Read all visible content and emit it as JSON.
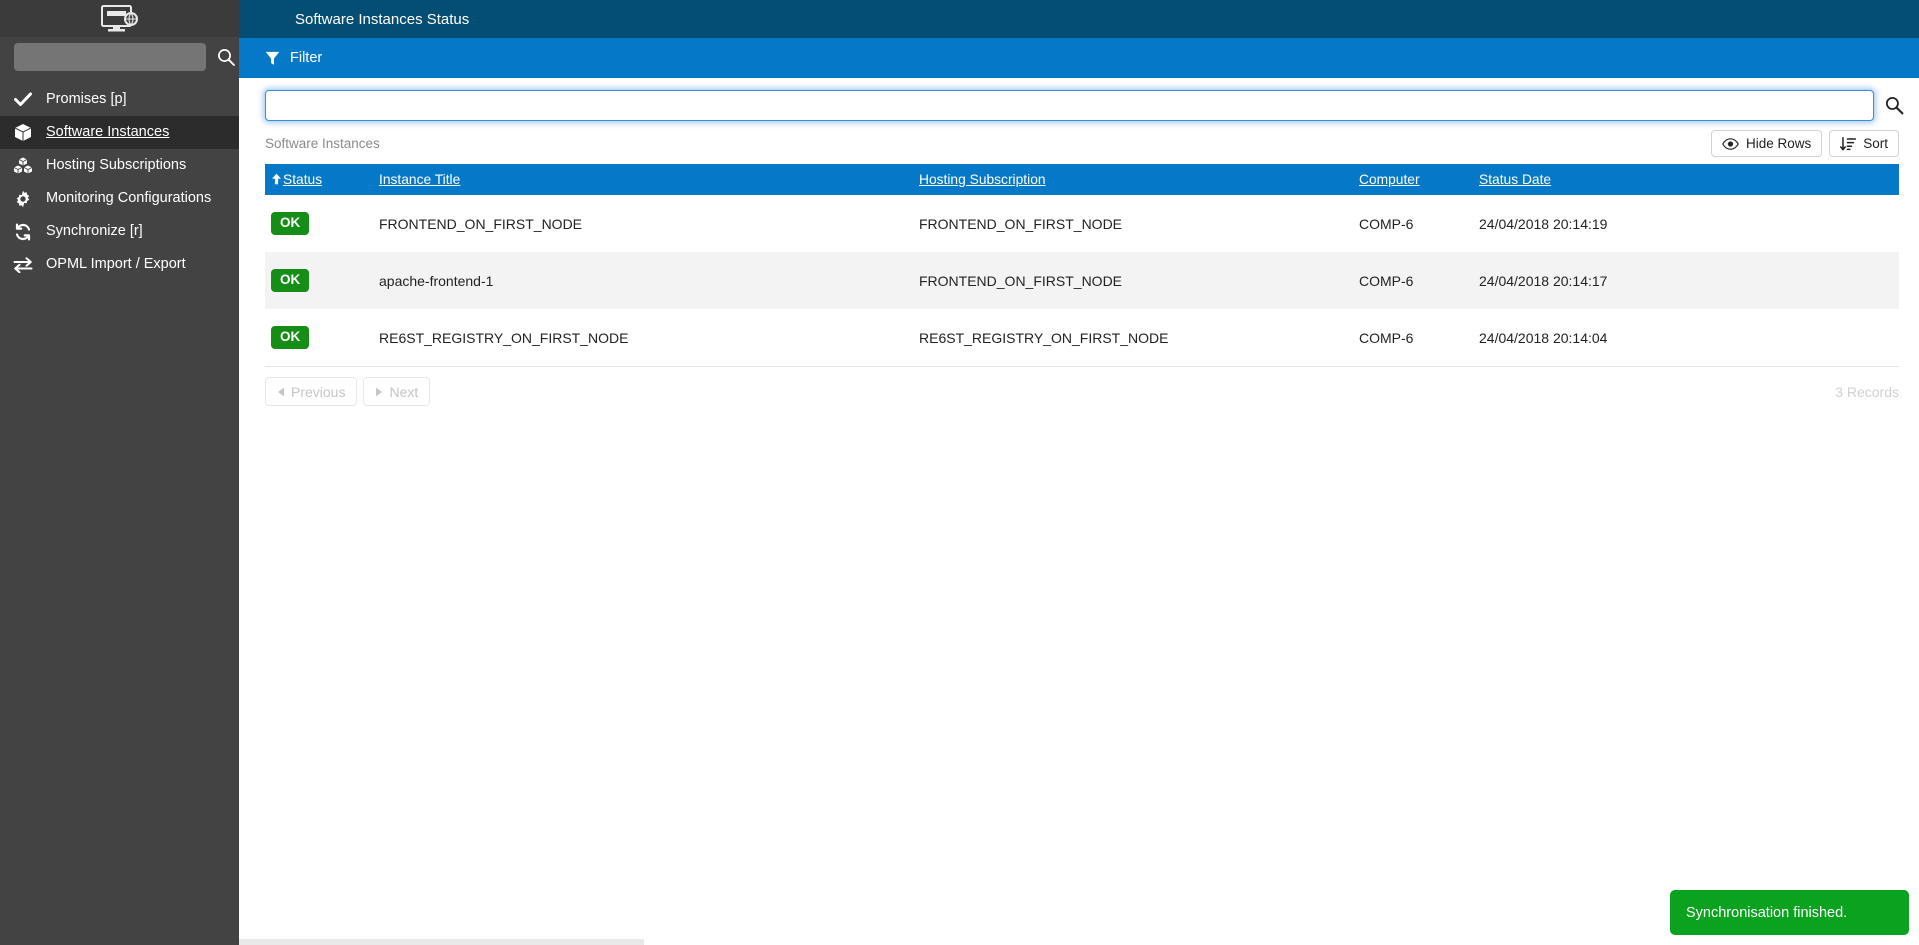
{
  "sidebar": {
    "logo_icon": "monitor-network-icon",
    "search": {
      "value": "",
      "placeholder": "",
      "icon": "search-icon"
    },
    "items": [
      {
        "label": "Promises [p]",
        "icon": "check-icon",
        "active": false
      },
      {
        "label": "Software Instances",
        "icon": "cube-icon",
        "active": true
      },
      {
        "label": "Hosting Subscriptions",
        "icon": "cubes-icon",
        "active": false
      },
      {
        "label": "Monitoring Configurations",
        "icon": "gear-icon",
        "active": false
      },
      {
        "label": "Synchronize [r]",
        "icon": "refresh-icon",
        "active": false
      },
      {
        "label": "OPML Import / Export",
        "icon": "exchange-icon",
        "active": false
      }
    ]
  },
  "header": {
    "title": "Software Instances Status",
    "filter_label": "Filter",
    "filter_icon": "funnel-icon"
  },
  "search": {
    "value": "",
    "placeholder": "",
    "icon": "search-icon"
  },
  "listing": {
    "caption": "Software Instances",
    "hide_rows_label": "Hide Rows",
    "hide_rows_icon": "eye-icon",
    "sort_label": "Sort",
    "sort_icon": "sort-amount-icon",
    "columns": [
      {
        "label": "Status",
        "sorted": "asc"
      },
      {
        "label": "Instance Title",
        "sorted": ""
      },
      {
        "label": "Hosting Subscription",
        "sorted": ""
      },
      {
        "label": "Computer",
        "sorted": ""
      },
      {
        "label": "Status Date",
        "sorted": ""
      }
    ],
    "rows": [
      {
        "status": "OK",
        "instance_title": "FRONTEND_ON_FIRST_NODE",
        "hosting_subscription": "FRONTEND_ON_FIRST_NODE",
        "computer": "COMP-6",
        "status_date": "24/04/2018 20:14:19"
      },
      {
        "status": "OK",
        "instance_title": "apache-frontend-1",
        "hosting_subscription": "FRONTEND_ON_FIRST_NODE",
        "computer": "COMP-6",
        "status_date": "24/04/2018 20:14:17"
      },
      {
        "status": "OK",
        "instance_title": "RE6ST_REGISTRY_ON_FIRST_NODE",
        "hosting_subscription": "RE6ST_REGISTRY_ON_FIRST_NODE",
        "computer": "COMP-6",
        "status_date": "24/04/2018 20:14:04"
      }
    ],
    "pager": {
      "previous_label": "Previous",
      "next_label": "Next",
      "previous_icon": "caret-left-icon",
      "next_icon": "caret-right-icon",
      "records_label": "3 Records"
    }
  },
  "toast": {
    "message": "Synchronisation finished."
  },
  "colors": {
    "titlebar": "#034e72",
    "filterbar": "#0579c7",
    "table_header": "#0579c7",
    "ok_badge": "#168d16",
    "toast": "#0aa21e",
    "sidebar": "#434343",
    "sidebar_active": "#2c2c2c"
  }
}
